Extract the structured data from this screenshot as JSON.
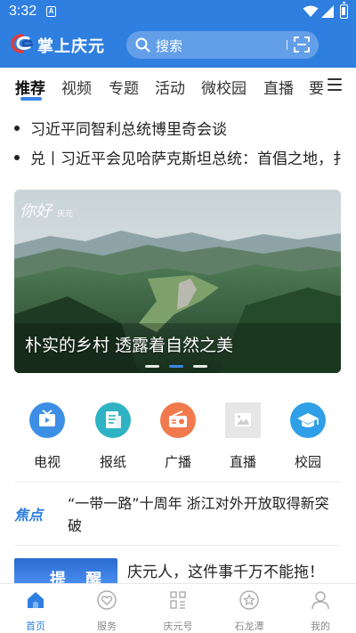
{
  "status_bar": {
    "time": "3:32",
    "notification_icon": "A"
  },
  "header": {
    "app_title": "掌上庆元",
    "search_placeholder": "搜索"
  },
  "tabs": [
    {
      "label": "推荐",
      "active": true
    },
    {
      "label": "视频"
    },
    {
      "label": "专题"
    },
    {
      "label": "活动"
    },
    {
      "label": "微校园"
    },
    {
      "label": "直播"
    },
    {
      "label": "要"
    }
  ],
  "headlines": [
    "习近平同智利总统博里奇会谈",
    "兑丨习近平会见哈萨克斯坦总统：首倡之地，扌"
  ],
  "banner": {
    "watermark_title": "你好",
    "watermark_sub": "庆元",
    "caption": "朴实的乡村 透露着自然之美",
    "active_dot": 2
  },
  "quick_links": [
    {
      "label": "电视",
      "icon": "tv-icon",
      "color": "#3d8fe6"
    },
    {
      "label": "报纸",
      "icon": "newspaper-icon",
      "color": "#2fb3c4"
    },
    {
      "label": "广播",
      "icon": "radio-icon",
      "color": "#f07a4e"
    },
    {
      "label": "直播",
      "icon": "image-placeholder-icon",
      "color": "#e6e6e6"
    },
    {
      "label": "校园",
      "icon": "graduation-cap-icon",
      "color": "#2f9fe8"
    }
  ],
  "focus": {
    "tag": "焦点",
    "text": "“一带一路”十周年 浙江对外开放取得新突破"
  },
  "news": [
    {
      "thumb_text": "提 醒",
      "title": "庆元人，这件事千万不能拖！"
    }
  ],
  "bottom_nav": [
    {
      "label": "首页",
      "icon": "home-icon",
      "active": true
    },
    {
      "label": "服务",
      "icon": "heart-icon"
    },
    {
      "label": "庆元号",
      "icon": "grid-icon"
    },
    {
      "label": "石龙潭",
      "icon": "star-icon"
    },
    {
      "label": "我的",
      "icon": "user-icon"
    }
  ],
  "colors": {
    "brand": "#2f7fe0",
    "accent": "#3a86e6"
  }
}
